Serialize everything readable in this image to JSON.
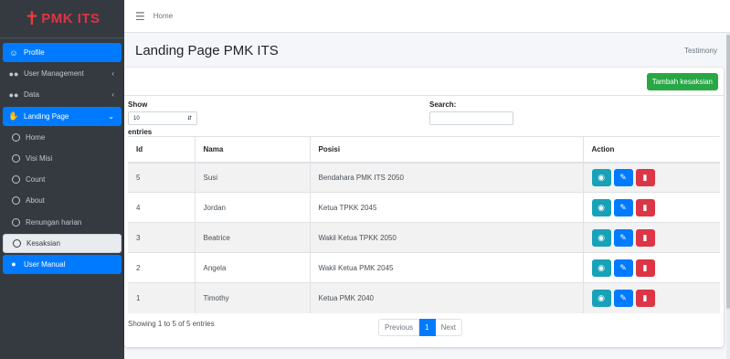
{
  "brand": {
    "cross": "✝",
    "name": "PMK ITS"
  },
  "topbar": {
    "home": "Home"
  },
  "sidebar": {
    "items": [
      {
        "label": "Profile",
        "icon": "user-circle-icon",
        "style": "primary"
      },
      {
        "label": "User Management",
        "icon": "users-icon",
        "style": "normal",
        "caret": "‹"
      },
      {
        "label": "Data",
        "icon": "user-group-icon",
        "style": "normal",
        "caret": "‹"
      },
      {
        "label": "Landing Page",
        "icon": "hand-icon",
        "style": "primary",
        "caret": "⌄"
      },
      {
        "label": "Home",
        "icon": "circle-icon",
        "style": "sub"
      },
      {
        "label": "Visi Misi",
        "icon": "circle-icon",
        "style": "sub"
      },
      {
        "label": "Count",
        "icon": "circle-icon",
        "style": "sub"
      },
      {
        "label": "About",
        "icon": "circle-icon",
        "style": "sub"
      },
      {
        "label": "Renungan harian",
        "icon": "circle-icon",
        "style": "sub"
      },
      {
        "label": "Kesaksian",
        "icon": "circle-icon",
        "style": "sub-active"
      },
      {
        "label": "User Manual",
        "icon": "user-manual-icon",
        "style": "primary"
      }
    ]
  },
  "header": {
    "title": "Landing Page PMK ITS",
    "breadcrumb": "Testimony"
  },
  "card": {
    "add_button": "Tambah kesaksian",
    "show_label": "Show",
    "show_value": "10",
    "entries_label": "entries",
    "search_label": "Search:",
    "search_value": ""
  },
  "table": {
    "headers": {
      "id": "Id",
      "nama": "Nama",
      "posisi": "Posisi",
      "action": "Action"
    },
    "rows": [
      {
        "id": "5",
        "nama": "Susi",
        "posisi": "Bendahara PMK ITS 2050"
      },
      {
        "id": "4",
        "nama": "Jordan",
        "posisi": "Ketua TPKK 2045"
      },
      {
        "id": "3",
        "nama": "Beatrice",
        "posisi": "Wakil Ketua TPKK 2050"
      },
      {
        "id": "2",
        "nama": "Angela",
        "posisi": "Wakil Ketua PMK 2045"
      },
      {
        "id": "1",
        "nama": "Timothy",
        "posisi": "Ketua PMK 2040"
      }
    ]
  },
  "footer": {
    "info": "Showing 1 to 5 of 5 entries",
    "previous": "Previous",
    "page": "1",
    "next": "Next"
  },
  "colors": {
    "primary": "#007bff",
    "success": "#28a745",
    "info": "#17a2b8",
    "danger": "#dc3545",
    "sidebar": "#343a40"
  }
}
